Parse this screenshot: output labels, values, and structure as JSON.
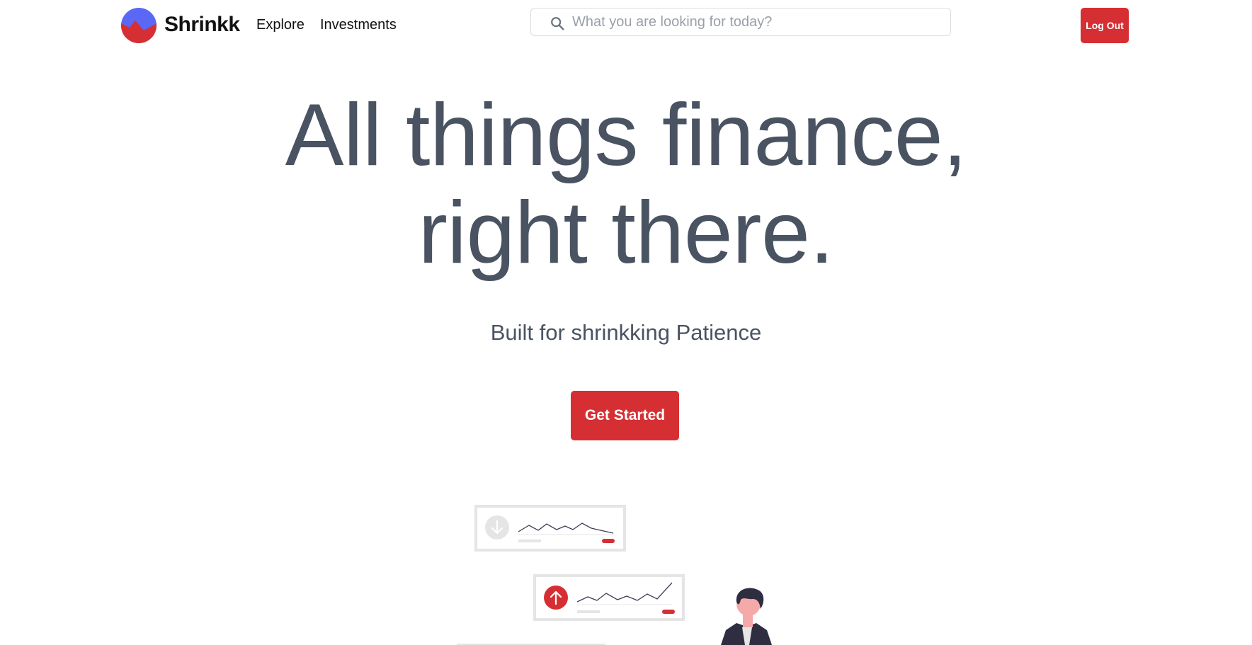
{
  "brand": {
    "name": "Shrinkk"
  },
  "nav": {
    "links": [
      "Explore",
      "Investments"
    ]
  },
  "search": {
    "placeholder": "What you are looking for today?"
  },
  "header": {
    "logout_label": "Log Out"
  },
  "hero": {
    "title_line1": "All things finance,",
    "title_line2": "right there.",
    "subtitle": "Built for shrinkking Patience",
    "cta_label": "Get Started"
  },
  "colors": {
    "accent": "#d62f33",
    "logo_blue": "#5b67f5",
    "heading": "#4a5362",
    "card_border": "#e5e5e5"
  }
}
